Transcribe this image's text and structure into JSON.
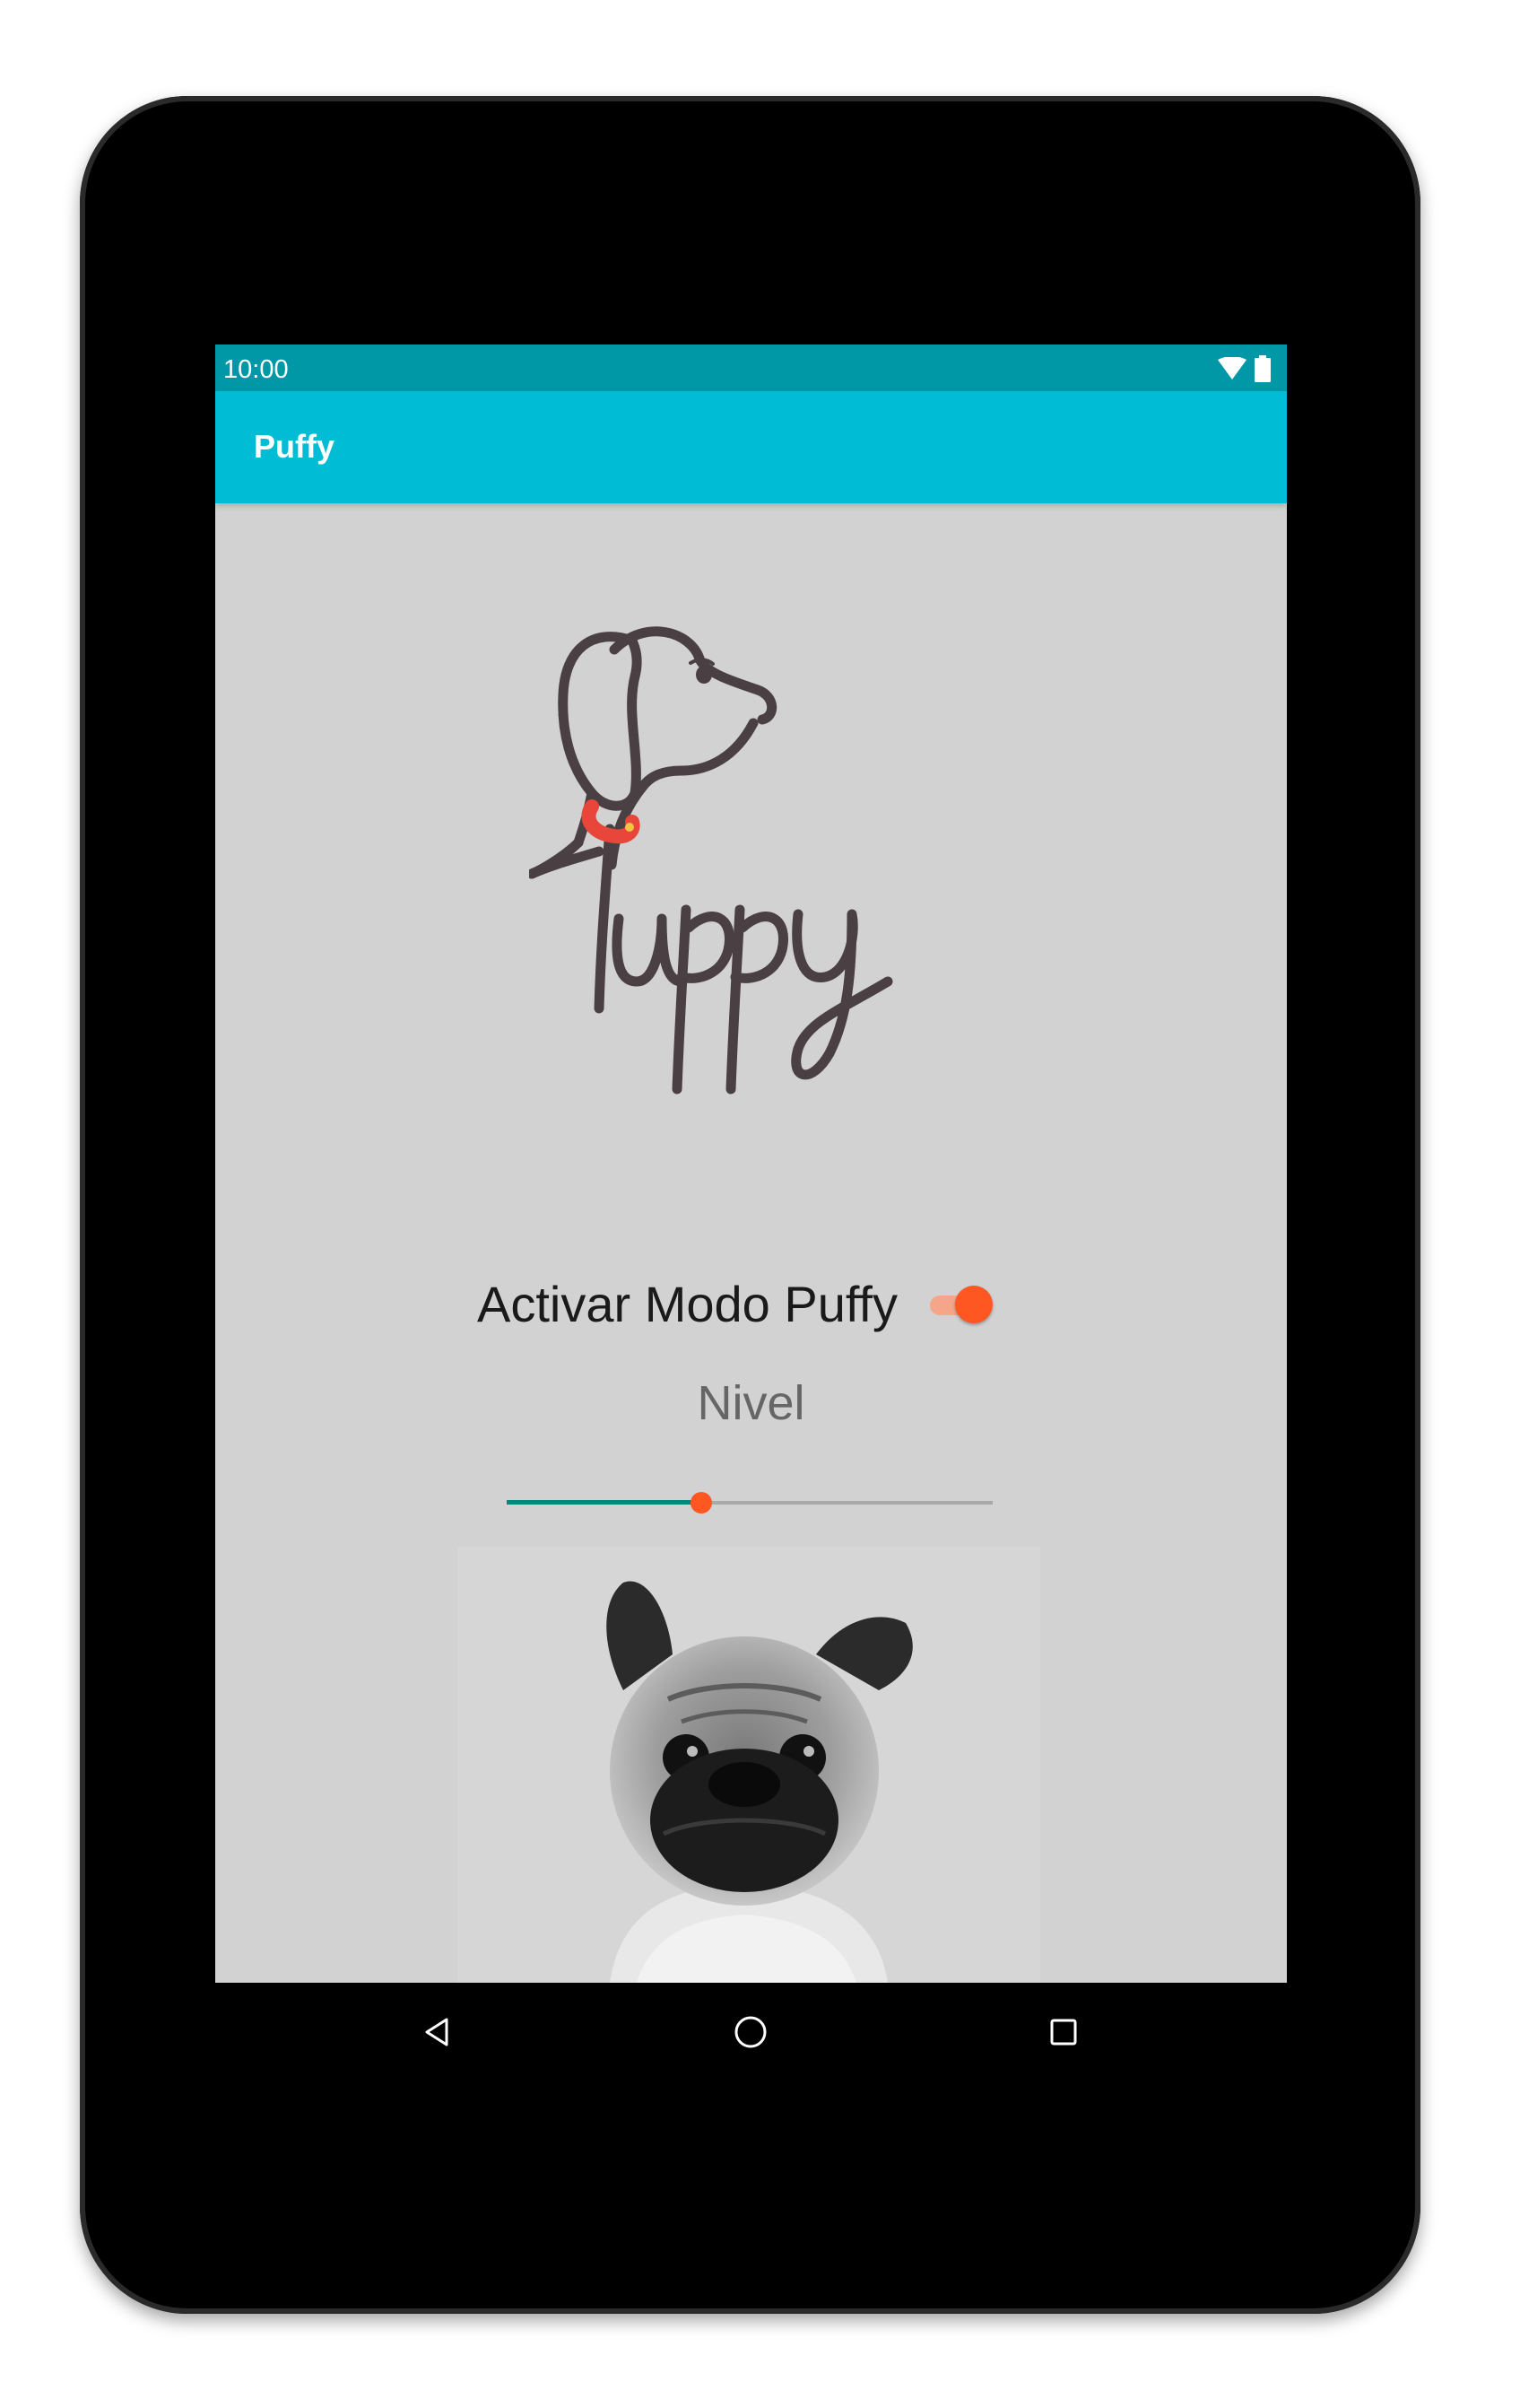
{
  "status_bar": {
    "time": "10:00",
    "icons": [
      "wifi-icon",
      "battery-icon"
    ]
  },
  "app_bar": {
    "title": "Puffy"
  },
  "logo": {
    "name": "puppy-logo",
    "text": "Puppy"
  },
  "toggle": {
    "label": "Activar Modo Puffy",
    "checked": true
  },
  "level": {
    "label": "Nivel",
    "value_fraction": 0.4
  },
  "nav_bar": {
    "buttons": [
      "back-icon",
      "home-icon",
      "recents-icon"
    ]
  },
  "colors": {
    "status_bar": "#0097a7",
    "app_bar": "#00bcd4",
    "accent": "#ff5722",
    "slider_fill": "#00897b",
    "screen_bg": "#d2d2d2",
    "logo_stroke": "#4a3f43",
    "collar": "#e8463a"
  }
}
